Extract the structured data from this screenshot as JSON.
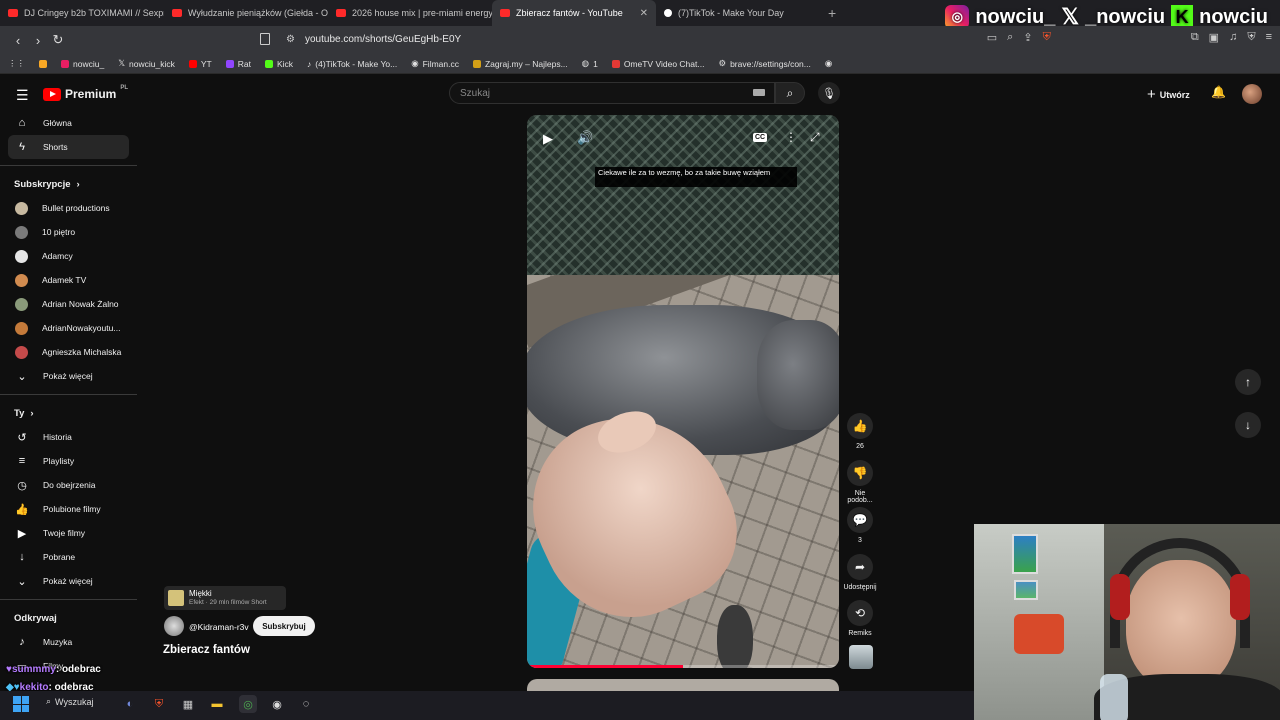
{
  "tabs": [
    {
      "title": "DJ Cringey b2b TOXIMAMI // Sexpre",
      "type": "yt"
    },
    {
      "title": "Wyłudzanie pieniążków (Giełda - Od",
      "type": "yt"
    },
    {
      "title": "2026 house mix | pre-miami energy",
      "type": "yt"
    },
    {
      "title": "Zbieracz fantów - YouTube",
      "type": "yt",
      "active": true
    },
    {
      "title": "(7)TikTok - Make Your Day",
      "type": "tt"
    }
  ],
  "overlay": {
    "instagram": "nowciu_",
    "x": "_nowciu",
    "kick": "nowciu"
  },
  "address": {
    "url": "youtube.com/shorts/GeuEgHb-E0Y"
  },
  "bookmarks": [
    "nowciu_",
    "nowciu_kick",
    "YT",
    "Rat",
    "Kick",
    "(4)TikTok - Make Yo...",
    "Filman.cc",
    "Zagraj.my – Najleps...",
    "1",
    "OmeTV Video Chat...",
    "brave://settings/con..."
  ],
  "header": {
    "logo": "Premium",
    "region": "PL",
    "search_placeholder": "Szukaj",
    "create_label": "Utwórz"
  },
  "sidebar": {
    "main": [
      {
        "label": "Główna",
        "icon": "home-icon"
      },
      {
        "label": "Shorts",
        "icon": "shorts-icon",
        "active": true
      }
    ],
    "subs_title": "Subskrypcje",
    "subs": [
      {
        "label": "Bullet productions",
        "color": "#c7b9a0"
      },
      {
        "label": "10 piętro",
        "color": "#7a7a7a"
      },
      {
        "label": "Adamcy",
        "color": "#e5e5e5"
      },
      {
        "label": "Adamek TV",
        "color": "#d18b4f"
      },
      {
        "label": "Adrian Nowak Żalno",
        "color": "#8a9a7a"
      },
      {
        "label": "AdrianNowakyoutu...",
        "color": "#c47a3a"
      },
      {
        "label": "Agnieszka Michalska",
        "color": "#c44a4a"
      }
    ],
    "subs_more": "Pokaż więcej",
    "you_title": "Ty",
    "you": [
      {
        "label": "Historia",
        "icon": "history-icon"
      },
      {
        "label": "Playlisty",
        "icon": "playlist-icon"
      },
      {
        "label": "Do obejrzenia",
        "icon": "clock-icon"
      },
      {
        "label": "Polubione filmy",
        "icon": "thumb-up-icon"
      },
      {
        "label": "Twoje filmy",
        "icon": "video-icon"
      },
      {
        "label": "Pobrane",
        "icon": "download-icon"
      }
    ],
    "you_more": "Pokaż więcej",
    "explore_title": "Odkrywaj",
    "explore": [
      {
        "label": "Muzyka",
        "icon": "music-icon"
      },
      {
        "label": "Filmy",
        "icon": "film-icon"
      }
    ]
  },
  "short": {
    "caption": "Ciekawe ile za to wezmę, bo za takie buwę wziąłem",
    "progress": 0.5,
    "effect_name": "Miękki",
    "effect_sub": "Efekt · 29 mln filmów Short",
    "channel": "@Kidraman-r3v",
    "subscribe": "Subskrybuj",
    "title": "Zbieracz fantów"
  },
  "actions": {
    "likes": "26",
    "dislike": "Nie podob...",
    "comments": "3",
    "share": "Udostępnij",
    "remix": "Remiks"
  },
  "chat": [
    {
      "user": "summmy",
      "msg": ": odebrac"
    },
    {
      "user": "kekito",
      "msg": ": odebrac"
    }
  ],
  "taskbar": {
    "search": "Wyszukaj"
  }
}
